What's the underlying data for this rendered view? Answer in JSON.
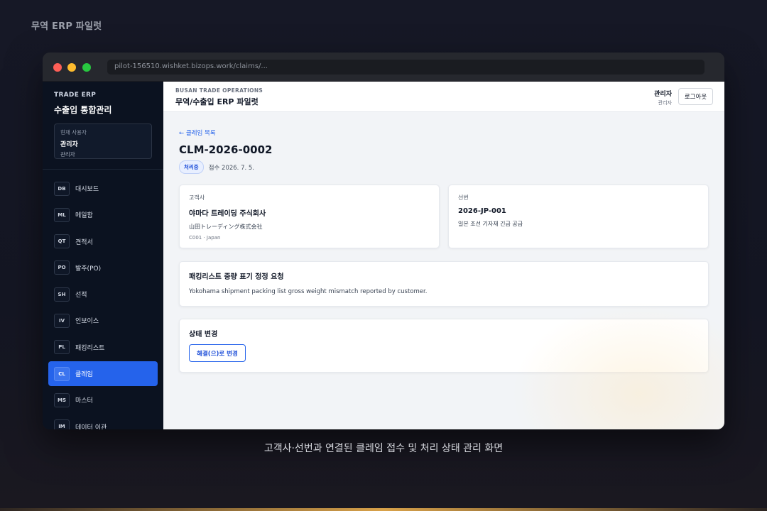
{
  "showcase": {
    "title": "무역 ERP 파일럿",
    "caption": "고객사·선번과 연결된 클레임 접수 및 처리 상태 관리 화면"
  },
  "browser": {
    "url": "pilot-156510.wishket.bizops.work/claims/..."
  },
  "sidebar": {
    "eyebrow": "TRADE ERP",
    "title": "수출입 통합관리",
    "user_card": {
      "label": "현재 사용자",
      "name": "관리자",
      "role": "관리자"
    },
    "items": [
      {
        "code": "DB",
        "label": "대시보드"
      },
      {
        "code": "ML",
        "label": "메일함"
      },
      {
        "code": "QT",
        "label": "견적서"
      },
      {
        "code": "PO",
        "label": "발주(PO)"
      },
      {
        "code": "SH",
        "label": "선적"
      },
      {
        "code": "IV",
        "label": "인보이스"
      },
      {
        "code": "PL",
        "label": "패킹리스트"
      },
      {
        "code": "CL",
        "label": "클레임"
      },
      {
        "code": "MS",
        "label": "마스터"
      },
      {
        "code": "IM",
        "label": "데이터 이관"
      }
    ],
    "active_index": 7
  },
  "topbar": {
    "eyebrow": "BUSAN TRADE OPERATIONS",
    "title": "무역/수출입 ERP 파일럿",
    "user_name": "관리자",
    "user_role": "관리자",
    "logout_label": "로그아웃"
  },
  "claim": {
    "back_label": "← 클레임 목록",
    "id": "CLM-2026-0002",
    "status": "처리중",
    "received": "접수 2026. 7. 5.",
    "customer": {
      "label": "고객사",
      "name": "야마다 트레이딩 주식회사",
      "name_local": "山田トレーディング株式会社",
      "meta": "C001 · Japan"
    },
    "vessel": {
      "label": "선번",
      "number": "2026-JP-001",
      "desc": "일본 조선 기자재 긴급 공급"
    },
    "issue": {
      "title": "패킹리스트 중량 표기 정정 요청",
      "body": "Yokohama shipment packing list gross weight mismatch reported by customer."
    },
    "status_change": {
      "title": "상태 변경",
      "button_label": "해결(으)로 변경"
    }
  },
  "colors": {
    "accent": "#2563eb",
    "sidebar_bg": "#0b1220",
    "main_bg": "#f2f4f7"
  }
}
